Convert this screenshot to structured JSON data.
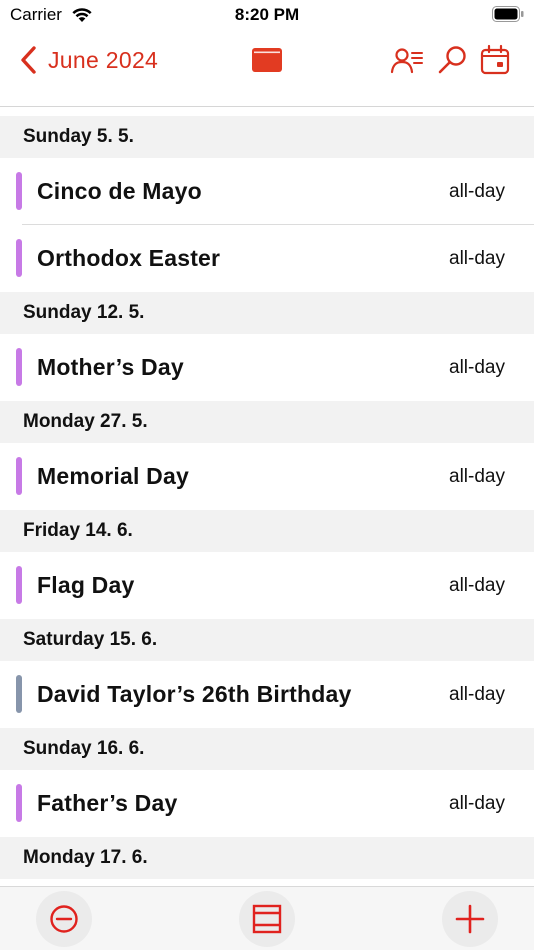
{
  "status_bar": {
    "carrier": "Carrier",
    "time": "8:20 PM"
  },
  "nav": {
    "back_label": "June 2024",
    "accent_color": "#d8301e",
    "icons": [
      "chevron-left-icon",
      "calendar-view-icon",
      "contacts-list-icon",
      "search-icon",
      "calendar-icon"
    ]
  },
  "list": {
    "sections": [
      {
        "date": "Sunday 5. 5.",
        "events": [
          {
            "title": "Cinco de Mayo",
            "time": "all-day",
            "color": "#c77ae6"
          },
          {
            "title": "Orthodox Easter",
            "time": "all-day",
            "color": "#c77ae6"
          }
        ]
      },
      {
        "date": "Sunday 12. 5.",
        "events": [
          {
            "title": "Mother’s Day",
            "time": "all-day",
            "color": "#c77ae6"
          }
        ]
      },
      {
        "date": "Monday 27. 5.",
        "events": [
          {
            "title": "Memorial Day",
            "time": "all-day",
            "color": "#c77ae6"
          }
        ]
      },
      {
        "date": "Friday 14. 6.",
        "events": [
          {
            "title": "Flag Day",
            "time": "all-day",
            "color": "#c77ae6"
          }
        ]
      },
      {
        "date": "Saturday 15. 6.",
        "events": [
          {
            "title": "David Taylor’s 26th Birthday",
            "time": "all-day",
            "color": "#8795ab"
          }
        ]
      },
      {
        "date": "Sunday 16. 6.",
        "events": [
          {
            "title": "Father’s Day",
            "time": "all-day",
            "color": "#c77ae6"
          }
        ]
      },
      {
        "date": "Monday 17. 6.",
        "events": []
      }
    ]
  },
  "tab_bar": {
    "icons": [
      "today-icon",
      "view-mode-icon",
      "add-icon"
    ]
  }
}
